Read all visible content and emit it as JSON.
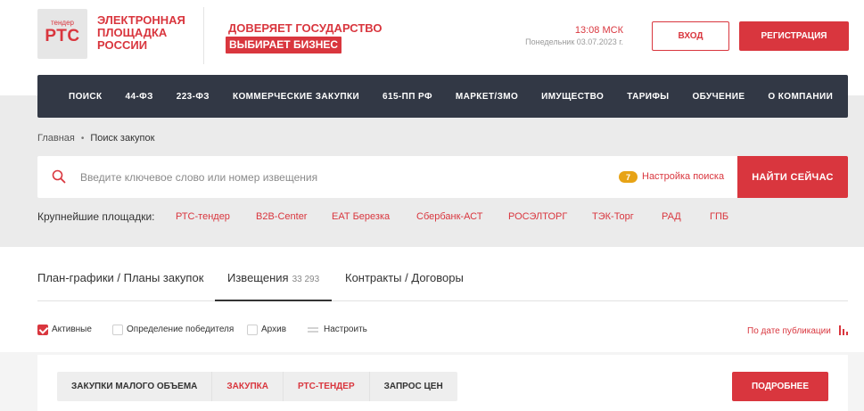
{
  "colors": {
    "accent": "#d9363e",
    "nav_bg": "#323845",
    "badge": "#e7a316",
    "zone_gray": "#ebebeb"
  },
  "logo": {
    "small": "тендер",
    "big": "РТС",
    "text": "ЭЛЕКТРОННАЯ\nПЛОЩАДКА\nРОССИИ"
  },
  "slogan": {
    "line1": "ДОВЕРЯЕТ ГОСУДАРСТВО",
    "line2": "ВЫБИРАЕТ БИЗНЕС"
  },
  "clock": {
    "time": "13:08 МСК",
    "date": "Понедельник 03.07.2023 г."
  },
  "auth": {
    "login": "ВХОД",
    "register": "РЕГИСТРАЦИЯ"
  },
  "nav": [
    "ПОИСК",
    "44-ФЗ",
    "223-ФЗ",
    "КОММЕРЧЕСКИЕ ЗАКУПКИ",
    "615-ПП РФ",
    "МАРКЕТ/ЗМО",
    "ИМУЩЕСТВО",
    "ТАРИФЫ",
    "ОБУЧЕНИЕ",
    "О КОМПАНИИ"
  ],
  "breadcrumb": {
    "home": "Главная",
    "separator": "•",
    "current": "Поиск закупок"
  },
  "search": {
    "placeholder": "Введите ключевое слово или номер извещения",
    "settings_count": "7",
    "settings_label": "Настройка поиска",
    "button": "НАЙТИ СЕЙЧАС",
    "icon": "search-icon"
  },
  "platforms": {
    "label": "Крупнейшие площадки:",
    "items": [
      "РТС-тендер",
      "B2B-Center",
      "ЕАТ Березка",
      "Сбербанк-АСТ",
      "РОСЭЛТОРГ",
      "ТЭК-Торг",
      "РАД",
      "ГПБ"
    ]
  },
  "tabs": [
    {
      "label": "План-графики / Планы закупок",
      "count": ""
    },
    {
      "label": "Извещения",
      "count": "33 293"
    },
    {
      "label": "Контракты / Договоры",
      "count": ""
    }
  ],
  "filters": {
    "active": "Активные",
    "winner": "Определение победителя",
    "archive": "Архив",
    "configure": "Настроить",
    "sort": "По дате публикации"
  },
  "card": {
    "tags": [
      "ЗАКУПКИ МАЛОГО ОБЪЕМА",
      "ЗАКУПКА",
      "РТС-ТЕНДЕР",
      "ЗАПРОС ЦЕН"
    ],
    "more": "ПОДРОБНЕЕ"
  }
}
